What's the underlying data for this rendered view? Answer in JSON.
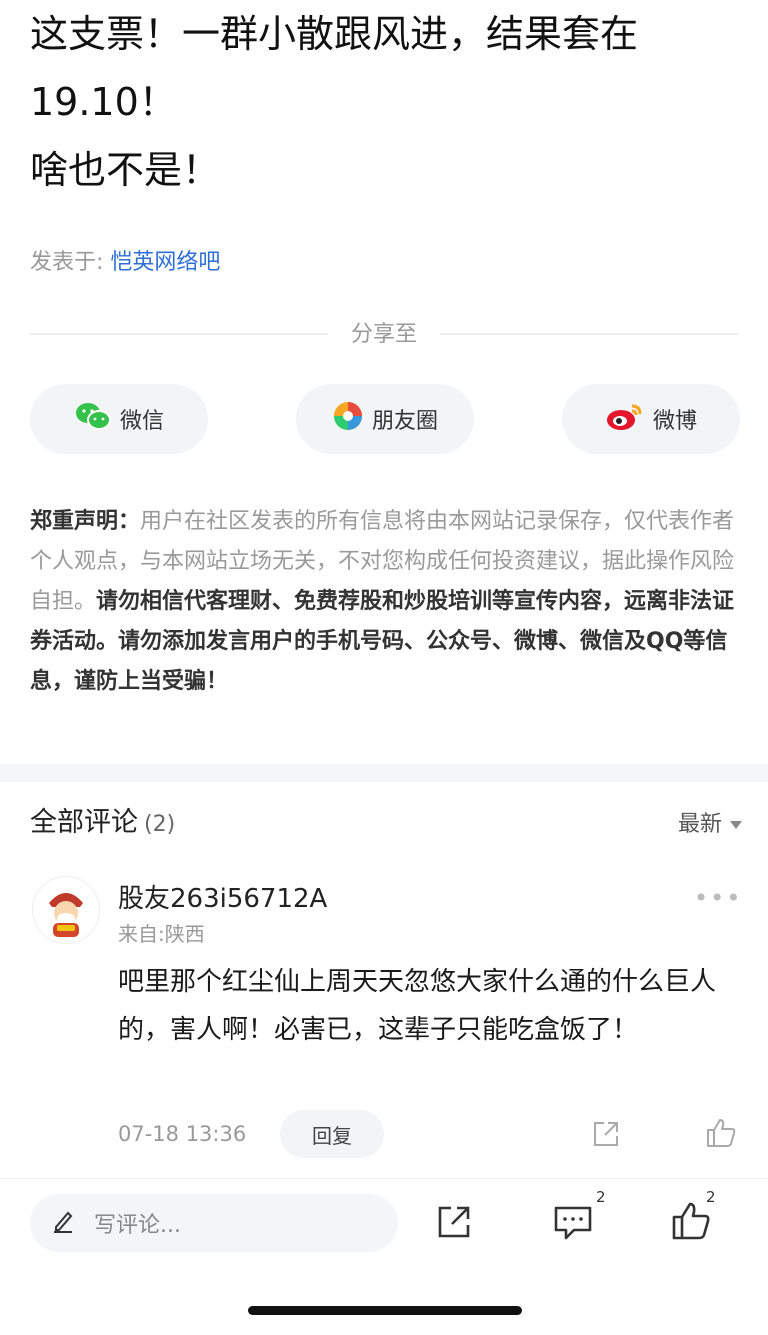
{
  "post": {
    "lines": [
      "这支票！一群小散跟风进，结果套在",
      "19.10！",
      "啥也不是！"
    ],
    "posted_in_label": "发表于:",
    "forum_name": "恺英网络吧"
  },
  "share": {
    "title": "分享至",
    "buttons": [
      {
        "label": "微信",
        "icon": "wechat-icon"
      },
      {
        "label": "朋友圈",
        "icon": "moments-icon"
      },
      {
        "label": "微博",
        "icon": "weibo-icon"
      }
    ]
  },
  "disclaimer": {
    "label": "郑重声明：",
    "normal_text": "用户在社区发表的所有信息将由本网站记录保存，仅代表作者个人观点，与本网站立场无关，不对您构成任何投资建议，据此操作风险自担。",
    "bold_text": "请勿相信代客理财、免费荐股和炒股培训等宣传内容，远离非法证券活动。请勿添加发言用户的手机号码、公众号、微博、微信及QQ等信息，谨防上当受骗！"
  },
  "comments": {
    "title": "全部评论",
    "count": "(2)",
    "sort_label": "最新",
    "items": [
      {
        "username": "股友263i56712A",
        "from": "来自:陕西",
        "text": "吧里那个红尘仙上周天天忽悠大家什么通的什么巨人的，害人啊！必害已，这辈子只能吃盒饭了！",
        "time": "07-18 13:36",
        "reply_label": "回复"
      }
    ]
  },
  "bottom_bar": {
    "placeholder": "写评论...",
    "comment_count": "2",
    "like_count": "2"
  },
  "colors": {
    "link": "#2d6fd6",
    "muted": "#999999"
  }
}
